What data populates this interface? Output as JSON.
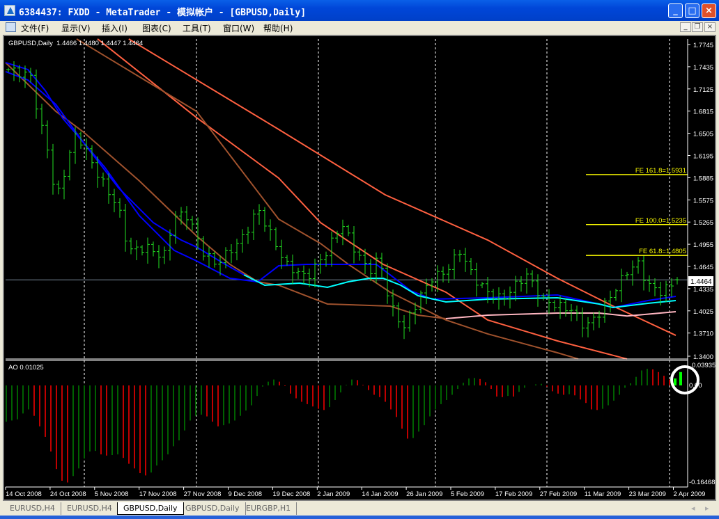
{
  "window": {
    "title": "6384437: FXDD - MetaTrader - 模拟帐户 - [GBPUSD,Daily]",
    "min": "_",
    "max": "□",
    "close": "×"
  },
  "menu": [
    "文件(F)",
    "显示(V)",
    "插入(I)",
    "图表(C)",
    "工具(T)",
    "窗口(W)",
    "帮助(H)"
  ],
  "mdi": {
    "min": "_",
    "restore": "❐",
    "close": "×"
  },
  "chart_header": "GBPUSD,Daily  1.4466 1.4480 1.4447 1.4464",
  "ao_header": "AO 0.01025",
  "current_price": "1.4464",
  "tabs": [
    {
      "label": "EURUSD,H4",
      "active": false
    },
    {
      "label": "EURUSD,H4",
      "active": false
    },
    {
      "label": "GBPUSD,Daily",
      "active": true
    },
    {
      "label": "GBPUSD,Daily",
      "active": false
    },
    {
      "label": "EURGBP,H1",
      "active": false
    }
  ],
  "colors": {
    "bars": "#22e022",
    "ao_up": "#008000",
    "ao_down": "#ff0000",
    "ao_highlight": "#00ff00",
    "fe": "#ffff00",
    "red_ma": "#ff6040",
    "brown_ma": "#a0522d",
    "pink_ma": "#ffb6c1",
    "blue_ma": "#0000ff",
    "cyan_ma": "#00ffff",
    "price_line": "#778899"
  },
  "chart_data": {
    "type": "line",
    "symbol": "GBPUSD",
    "timeframe": "Daily",
    "ohlc_last": {
      "open": 1.4466,
      "high": 1.448,
      "low": 1.4447,
      "close": 1.4464
    },
    "price_axis": {
      "labels": [
        "1.7745",
        "1.7435",
        "1.7125",
        "1.6815",
        "1.6505",
        "1.6195",
        "1.5885",
        "1.5575",
        "1.5265",
        "1.4955",
        "1.4645",
        "1.4335",
        "1.4025",
        "1.3710",
        "1.3400"
      ],
      "ylim": [
        1.34,
        1.7745
      ]
    },
    "date_labels": [
      "14 Oct 2008",
      "24 Oct 2008",
      "5 Nov 2008",
      "17 Nov 2008",
      "27 Nov 2008",
      "9 Dec 2008",
      "19 Dec 2008",
      "2 Jan 2009",
      "14 Jan 2009",
      "26 Jan 2009",
      "5 Feb 2009",
      "17 Feb 2009",
      "27 Feb 2009",
      "11 Mar 2009",
      "23 Mar 2009",
      "2 Apr 2009"
    ],
    "bar_count": 121,
    "close_keypoints": [
      [
        0,
        1.7396
      ],
      [
        4.1,
        1.73
      ],
      [
        5.4,
        1.672
      ],
      [
        7.25,
        1.623
      ],
      [
        8.5,
        1.555
      ],
      [
        11,
        1.623
      ],
      [
        12.25,
        1.652
      ],
      [
        16,
        1.594
      ],
      [
        19.75,
        1.546
      ],
      [
        21.6,
        1.487
      ],
      [
        24.75,
        1.492
      ],
      [
        27.9,
        1.478
      ],
      [
        29.75,
        1.536
      ],
      [
        32.25,
        1.536
      ],
      [
        34.75,
        1.487
      ],
      [
        37.25,
        1.468
      ],
      [
        39.75,
        1.487
      ],
      [
        42.25,
        1.507
      ],
      [
        44.75,
        1.546
      ],
      [
        47.25,
        1.507
      ],
      [
        49.75,
        1.468
      ],
      [
        53.5,
        1.449
      ],
      [
        57.25,
        1.487
      ],
      [
        59.75,
        1.526
      ],
      [
        62.25,
        1.487
      ],
      [
        64.75,
        1.458
      ],
      [
        66.6,
        1.478
      ],
      [
        68.5,
        1.41
      ],
      [
        71,
        1.38
      ],
      [
        73.5,
        1.419
      ],
      [
        76,
        1.449
      ],
      [
        78.5,
        1.458
      ],
      [
        81,
        1.487
      ],
      [
        83.5,
        1.449
      ],
      [
        86,
        1.429
      ],
      [
        88.5,
        1.419
      ],
      [
        91,
        1.439
      ],
      [
        92.9,
        1.454
      ],
      [
        96,
        1.419
      ],
      [
        98.5,
        1.41
      ],
      [
        101,
        1.405
      ],
      [
        103.5,
        1.38
      ],
      [
        106,
        1.4
      ],
      [
        108.5,
        1.429
      ],
      [
        111,
        1.458
      ],
      [
        112.9,
        1.47
      ],
      [
        114.75,
        1.439
      ],
      [
        117.25,
        1.429
      ],
      [
        120,
        1.4464
      ]
    ],
    "moving_averages": [
      {
        "name": "red-ma-1",
        "color": "#ff6040",
        "points": [
          [
            21.6,
            1.7823
          ],
          [
            48.5,
            1.6562
          ],
          [
            67.6,
            1.565
          ],
          [
            86,
            1.5019
          ],
          [
            98.5,
            1.4486
          ],
          [
            108.5,
            1.4098
          ],
          [
            119.75,
            1.369
          ]
        ]
      },
      {
        "name": "red-ma-2",
        "color": "#ff6040",
        "points": [
          [
            16,
            1.7823
          ],
          [
            33.75,
            1.6727
          ],
          [
            48.5,
            1.5883
          ],
          [
            56,
            1.5262
          ],
          [
            67.25,
            1.468
          ],
          [
            78.5,
            1.4292
          ],
          [
            86,
            1.3904
          ],
          [
            98.5,
            1.3613
          ],
          [
            111,
            1.3361
          ]
        ]
      },
      {
        "name": "brown-ma-1",
        "color": "#a0522d",
        "points": [
          [
            12.25,
            1.7823
          ],
          [
            33.75,
            1.6814
          ],
          [
            48.5,
            1.531
          ],
          [
            56,
            1.4971
          ],
          [
            61,
            1.468
          ],
          [
            68.5,
            1.4292
          ],
          [
            78.5,
            1.3904
          ],
          [
            86,
            1.371
          ],
          [
            98.5,
            1.3448
          ],
          [
            102.25,
            1.3361
          ]
        ]
      },
      {
        "name": "brown-ma-2",
        "color": "#a0522d",
        "points": [
          [
            -0.5,
            1.7493
          ],
          [
            8.5,
            1.6814
          ],
          [
            13.5,
            1.6523
          ],
          [
            23.5,
            1.5844
          ],
          [
            33.75,
            1.5078
          ],
          [
            39.75,
            1.468
          ],
          [
            44.75,
            1.4437
          ],
          [
            48.5,
            1.4389
          ],
          [
            57.25,
            1.4127
          ],
          [
            68.5,
            1.4098
          ],
          [
            73.5,
            1.3972
          ],
          [
            78.5,
            1.3923
          ]
        ]
      },
      {
        "name": "pink-ma",
        "color": "#ffb6c1",
        "points": [
          [
            78.5,
            1.3923
          ],
          [
            86,
            1.3972
          ],
          [
            98.5,
            1.4001
          ],
          [
            106,
            1.4001
          ],
          [
            111,
            1.396
          ],
          [
            119.75,
            1.402
          ]
        ]
      },
      {
        "name": "blue-ma-1",
        "color": "#0000ff",
        "points": [
          [
            -0.5,
            1.7493
          ],
          [
            3.5,
            1.7396
          ],
          [
            6.6,
            1.7105
          ],
          [
            9.75,
            1.6717
          ],
          [
            17.25,
            1.6038
          ],
          [
            23.5,
            1.5359
          ],
          [
            29.75,
            1.4874
          ],
          [
            33.75,
            1.4728
          ],
          [
            39.75,
            1.4486
          ],
          [
            44.75,
            1.4437
          ],
          [
            48.5,
            1.466
          ],
          [
            53.5,
            1.468
          ],
          [
            66,
            1.468
          ],
          [
            68.5,
            1.4534
          ],
          [
            72.25,
            1.4311
          ],
          [
            76,
            1.4195
          ],
          [
            86,
            1.4214
          ],
          [
            98.5,
            1.4253
          ],
          [
            106,
            1.4127
          ],
          [
            108.5,
            1.4078
          ],
          [
            114.75,
            1.4175
          ],
          [
            119.75,
            1.4234
          ]
        ]
      },
      {
        "name": "cyan-ma",
        "color": "#00ffff",
        "points": [
          [
            42.25,
            1.4534
          ],
          [
            46,
            1.4389
          ],
          [
            52.25,
            1.4418
          ],
          [
            57.25,
            1.436
          ],
          [
            61,
            1.4437
          ],
          [
            64.75,
            1.4486
          ],
          [
            67.25,
            1.4486
          ],
          [
            70.4,
            1.4389
          ],
          [
            73.5,
            1.4243
          ],
          [
            78.5,
            1.4156
          ],
          [
            86,
            1.4195
          ],
          [
            98.5,
            1.4214
          ],
          [
            106,
            1.4127
          ],
          [
            108.5,
            1.4078
          ],
          [
            114.75,
            1.4137
          ],
          [
            119.75,
            1.4175
          ]
        ]
      },
      {
        "name": "blue-ma-2",
        "color": "#0000ff",
        "points": [
          [
            -0.5,
            1.7367
          ],
          [
            3.5,
            1.725
          ],
          [
            8.5,
            1.6911
          ],
          [
            13.5,
            1.6377
          ],
          [
            19.75,
            1.5747
          ],
          [
            26,
            1.5262
          ],
          [
            31,
            1.5019
          ],
          [
            33.75,
            1.4922
          ],
          [
            38.5,
            1.4699
          ],
          [
            42.25,
            1.4534
          ]
        ]
      }
    ],
    "fibo_expansion": [
      {
        "label": "FE 161.8=1.5931",
        "price": 1.5931
      },
      {
        "label": "FE 100.0=1.5235",
        "price": 1.5235
      },
      {
        "label": "FE 61.8=1.4805",
        "price": 1.4805
      }
    ],
    "ao": {
      "name": "AO",
      "axis_labels": {
        "max": "0.03935",
        "zero": "0.00",
        "min": "-0.16468"
      },
      "ylim": [
        -0.16468,
        0.03935
      ],
      "values": [
        -0.062,
        -0.06,
        -0.058,
        -0.048,
        -0.041,
        -0.052,
        -0.07,
        -0.088,
        -0.113,
        -0.143,
        -0.163,
        -0.166,
        -0.155,
        -0.142,
        -0.125,
        -0.113,
        -0.112,
        -0.118,
        -0.12,
        -0.119,
        -0.118,
        -0.124,
        -0.134,
        -0.142,
        -0.15,
        -0.154,
        -0.149,
        -0.137,
        -0.128,
        -0.118,
        -0.104,
        -0.094,
        -0.077,
        -0.06,
        -0.052,
        -0.05,
        -0.053,
        -0.062,
        -0.07,
        -0.068,
        -0.065,
        -0.06,
        -0.052,
        -0.043,
        -0.034,
        -0.018,
        -0.002,
        0.007,
        0.011,
        0.007,
        -0.001,
        -0.014,
        -0.022,
        -0.028,
        -0.032,
        -0.036,
        -0.04,
        -0.042,
        -0.037,
        -0.025,
        -0.012,
        0.001,
        0.011,
        0.01,
        0.001,
        -0.008,
        -0.016,
        -0.02,
        -0.028,
        -0.041,
        -0.054,
        -0.074,
        -0.091,
        -0.09,
        -0.079,
        -0.068,
        -0.053,
        -0.041,
        -0.032,
        -0.025,
        -0.016,
        -0.006,
        0.005,
        0.013,
        0.014,
        0.012,
        0.006,
        -0.006,
        -0.019,
        -0.02,
        -0.018,
        -0.019,
        -0.011,
        -0.004,
        0.0,
        0.002,
        0.003,
        -0.002,
        -0.01,
        -0.014,
        -0.016,
        -0.015,
        -0.017,
        -0.024,
        -0.03,
        -0.041,
        -0.042,
        -0.04,
        -0.034,
        -0.026,
        -0.016,
        -0.004,
        0.004,
        0.016,
        0.028,
        0.031,
        0.03,
        0.025,
        0.018,
        0.011,
        0.013,
        0.025
      ],
      "highlighted_last": 2
    }
  }
}
